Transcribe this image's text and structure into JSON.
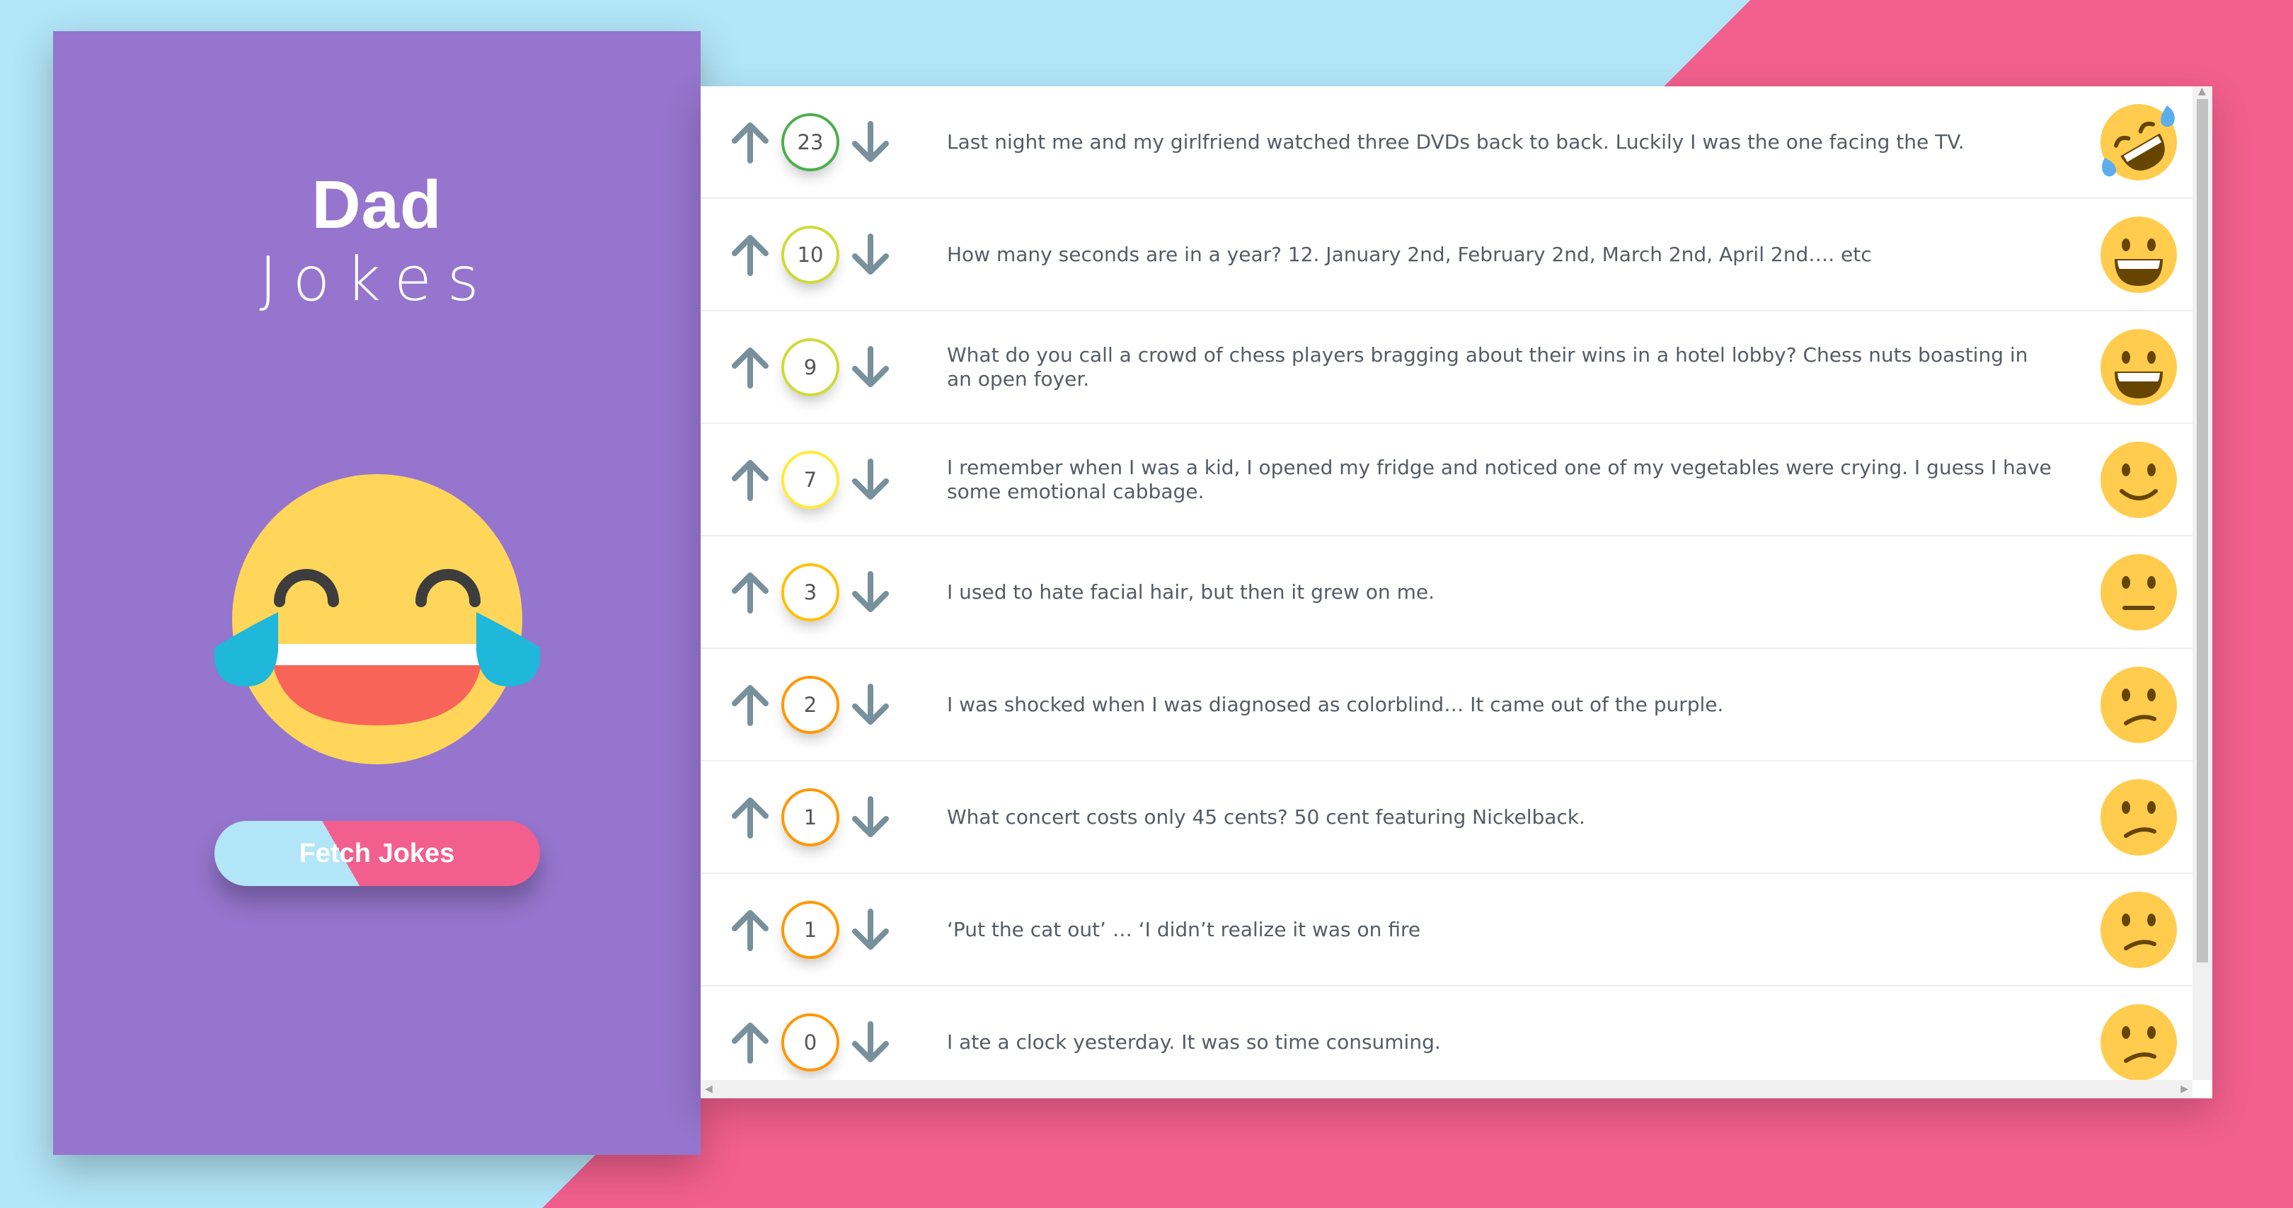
{
  "app": {
    "title_line1": "Dad",
    "title_line2": "Jokes",
    "fetch_button": "Fetch Jokes"
  },
  "jokes": [
    {
      "score": "23",
      "text": "Last night me and my girlfriend watched three DVDs back to back. Luckily I was the one facing the TV.",
      "color": "#4caf50",
      "emoji": "rofl-face-icon"
    },
    {
      "score": "10",
      "text": "How many seconds are in a year? 12. January 2nd, February 2nd, March 2nd, April 2nd…. etc",
      "color": "#cddc39",
      "emoji": "grinning-face-icon"
    },
    {
      "score": "9",
      "text": "What do you call a crowd of chess players bragging about their wins in a hotel lobby? Chess nuts boasting in an open foyer.",
      "color": "#cddc39",
      "emoji": "grinning-face-icon"
    },
    {
      "score": "7",
      "text": "I remember when I was a kid, I opened my fridge and noticed one of my vegetables were crying. I guess I have some emotional cabbage.",
      "color": "#ffeb3b",
      "emoji": "slight-smile-icon"
    },
    {
      "score": "3",
      "text": "I used to hate facial hair, but then it grew on me.",
      "color": "#ffc107",
      "emoji": "neutral-face-icon"
    },
    {
      "score": "2",
      "text": "I was shocked when I was diagnosed as colorblind… It came out of the purple.",
      "color": "#ff9800",
      "emoji": "confused-face-icon"
    },
    {
      "score": "1",
      "text": "What concert costs only 45 cents? 50 cent featuring Nickelback.",
      "color": "#ff9800",
      "emoji": "confused-face-icon"
    },
    {
      "score": "1",
      "text": "‘Put the cat out’ … ‘I didn’t realize it was on fire",
      "color": "#ff9800",
      "emoji": "confused-face-icon"
    },
    {
      "score": "0",
      "text": "I ate a clock yesterday. It was so time consuming.",
      "color": "#ff9800",
      "emoji": "confused-face-icon"
    }
  ]
}
